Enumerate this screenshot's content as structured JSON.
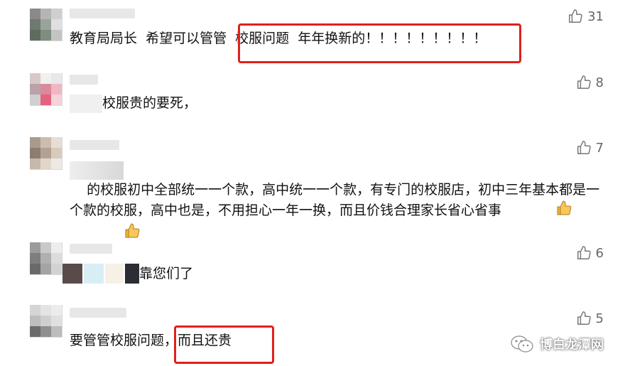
{
  "comments": [
    {
      "text": "教育局局长  希望可以管管  校服问题  年年换新的！！！！！！！！！",
      "likes": "31"
    },
    {
      "text": "校服贵的要死，",
      "likes": "8"
    },
    {
      "text": "的校服初中全部统一一个款，高中统一一个款，有专门的校服店，初中三年基本都是一个款的校服，高中也是，不用担心一年一换，而且价钱合理家长省心省事",
      "likes": "7"
    },
    {
      "text": "靠您们了",
      "likes": "6"
    },
    {
      "text": "要管管校服问题，而且还贵",
      "likes": "5"
    }
  ],
  "watermark": "博白龙潭网",
  "colors": {
    "highlight": "#e0201b",
    "like_gray": "#666666",
    "text": "#111111"
  },
  "icons": {
    "like": "thumbs-up-icon",
    "emoji": "thumbs-up-emoji",
    "watermark": "wechat-icon"
  }
}
